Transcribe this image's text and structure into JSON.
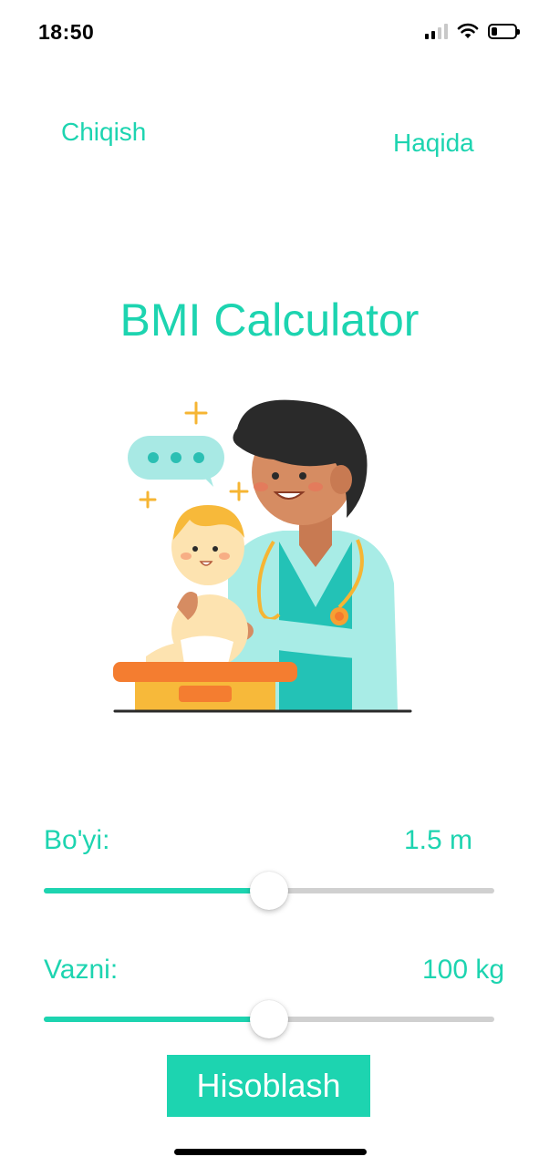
{
  "status_bar": {
    "time": "18:50"
  },
  "nav": {
    "exit_label": "Chiqish",
    "about_label": "Haqida"
  },
  "title": "BMI Calculator",
  "height": {
    "label": "Bo'yi:",
    "value_text": "1.5 m",
    "slider_fraction": 0.5
  },
  "weight": {
    "label": "Vazni:",
    "value_text": "100 kg",
    "slider_fraction": 0.5
  },
  "calculate_button": {
    "label": "Hisoblash"
  },
  "colors": {
    "accent": "#1dd4b0",
    "track": "#d0d0d0",
    "button_text": "#ffffff"
  },
  "illustration": {
    "icon": "doctor-with-baby-on-scale-illustration"
  }
}
